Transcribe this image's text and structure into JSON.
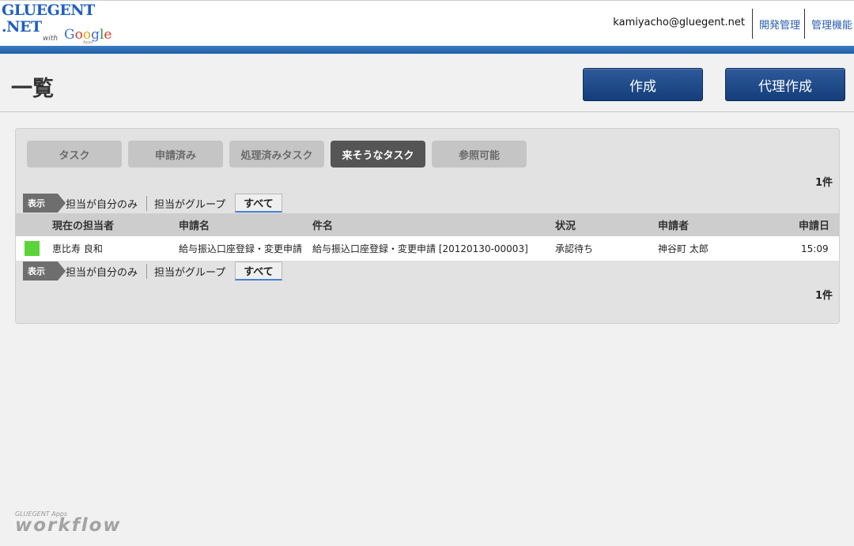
{
  "header": {
    "logo_line1": "GLUEGENT",
    "logo_line2": ".NET",
    "logo_with": "with",
    "logo_google": "Google",
    "logo_apps": "Apps",
    "user_email": "kamiyacho@gluegent.net",
    "links": [
      "開発管理",
      "管理機能"
    ]
  },
  "page": {
    "title": "一覧",
    "create_button": "作成",
    "proxy_create_button": "代理作成"
  },
  "tabs": [
    {
      "label": "タスク",
      "active": false
    },
    {
      "label": "申請済み",
      "active": false
    },
    {
      "label": "処理済みタスク",
      "active": false
    },
    {
      "label": "来そうなタスク",
      "active": true
    },
    {
      "label": "参照可能",
      "active": false
    }
  ],
  "count_text": "1件",
  "filter": {
    "label": "表示",
    "options": [
      "担当が自分のみ",
      "担当がグループ",
      "すべて"
    ],
    "selected": "すべて"
  },
  "table": {
    "columns": [
      "現在の担当者",
      "申請名",
      "件名",
      "状況",
      "申請者",
      "申請日"
    ],
    "rows": [
      {
        "status_color": "#5bd43a",
        "assignee": "恵比寿 良和",
        "request_name": "給与振込口座登録・変更申請",
        "subject": "給与振込口座登録・変更申請 [20120130-00003]",
        "status": "承認待ち",
        "applicant": "神谷町 太郎",
        "date": "15:09"
      }
    ]
  },
  "footer": {
    "brand_small": "GLUEGENT Apps",
    "brand_big": "workflow"
  }
}
